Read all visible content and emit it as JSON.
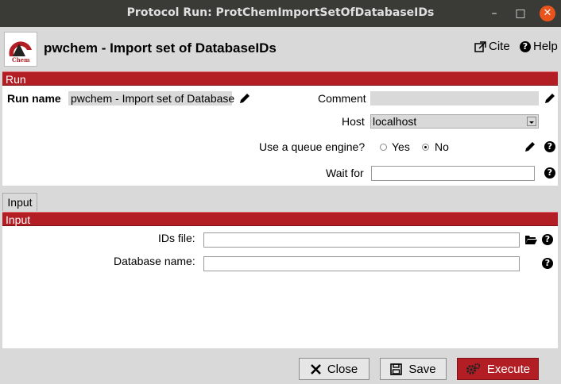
{
  "window": {
    "title": "Protocol Run: ProtChemImportSetOfDatabaseIDs",
    "min_symbol": "–",
    "max_symbol": "□",
    "close_symbol": "✕"
  },
  "header": {
    "app_title": "pwchem - Import set of DatabaseIDs",
    "logo_text": "Chem",
    "cite_label": "Cite",
    "help_label": "Help"
  },
  "run": {
    "section_label": "Run",
    "run_name_label": "Run name",
    "run_name_value": "pwchem - Import set of Database",
    "comment_label": "Comment",
    "comment_value": "",
    "host_label": "Host",
    "host_value": "localhost",
    "queue_label": "Use a queue engine?",
    "queue_yes": "Yes",
    "queue_no": "No",
    "queue_selected": "No",
    "wait_label": "Wait for",
    "wait_value": ""
  },
  "tabs": [
    {
      "label": "Input"
    }
  ],
  "input": {
    "section_label": "Input",
    "ids_file_label": "IDs file:",
    "ids_file_value": "",
    "db_name_label": "Database name:",
    "db_name_value": ""
  },
  "footer": {
    "close_label": "Close",
    "save_label": "Save",
    "execute_label": "Execute"
  },
  "colors": {
    "accent": "#b31e24",
    "titlebar": "#3a3a37",
    "close_button": "#e9541d",
    "background": "#d9d9d9"
  }
}
